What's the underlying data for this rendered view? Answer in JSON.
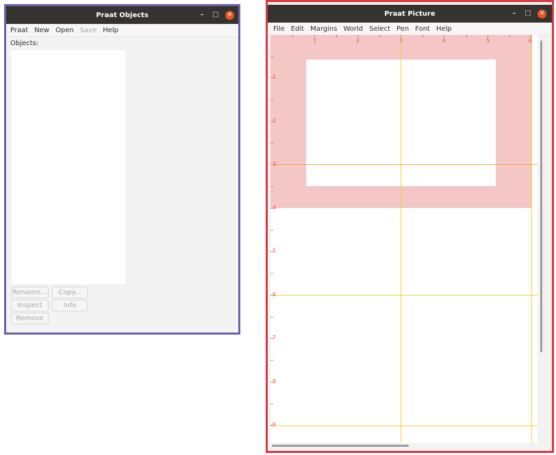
{
  "objects_window": {
    "title": "Praat Objects",
    "menu": [
      {
        "label": "Praat",
        "enabled": true
      },
      {
        "label": "New",
        "enabled": true
      },
      {
        "label": "Open",
        "enabled": true
      },
      {
        "label": "Save",
        "enabled": false
      },
      {
        "label": "Help",
        "enabled": true
      }
    ],
    "objects_label": "Objects:",
    "buttons": {
      "rename": "Rename...",
      "copy": "Copy...",
      "inspect": "Inspect",
      "info": "Info",
      "remove": "Remove"
    }
  },
  "picture_window": {
    "title": "Praat Picture",
    "menu": [
      {
        "label": "File"
      },
      {
        "label": "Edit"
      },
      {
        "label": "Margins"
      },
      {
        "label": "World"
      },
      {
        "label": "Select"
      },
      {
        "label": "Pen"
      },
      {
        "label": "Font"
      },
      {
        "label": "Help"
      }
    ],
    "ruler_top": [
      "1",
      "2",
      "3",
      "4",
      "5",
      "6"
    ],
    "ruler_left": [
      "1",
      "2",
      "3",
      "4",
      "5",
      "6",
      "7",
      "8",
      "9"
    ]
  },
  "window_controls": {
    "minimize": "–",
    "maximize": "□",
    "close": "✕"
  },
  "colors": {
    "objects_frame": "#6a5fa8",
    "picture_frame": "#d9363e",
    "selection_pink": "#f4c6c6",
    "ruler": "#e05a45",
    "guide_yellow": "#f5d040",
    "titlebar": "#353330",
    "close_button": "#e95420"
  }
}
